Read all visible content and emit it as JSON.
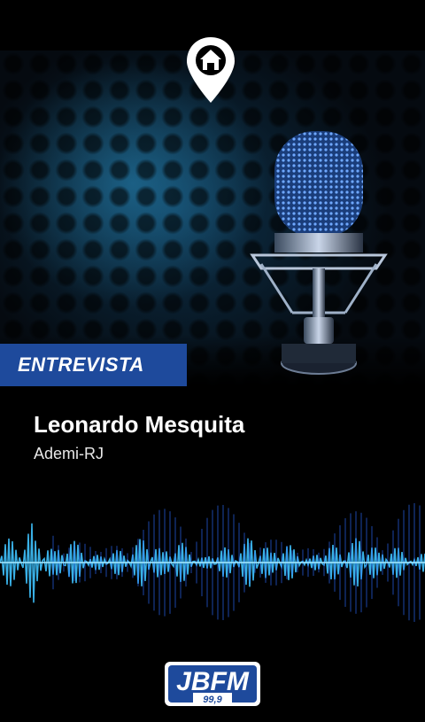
{
  "header": {
    "icon": "home-location-pin-icon"
  },
  "hero": {
    "image": "studio-microphone"
  },
  "tag": {
    "label": "ENTREVISTA",
    "color": "#1e4a9c"
  },
  "guest": {
    "name": "Leonardo Mesquita",
    "organization": "Ademi-RJ"
  },
  "footer": {
    "logo_text": "JBFM",
    "frequency": "99,9"
  },
  "colors": {
    "accent": "#1e4a9c",
    "wave": "#3fc3ff",
    "background": "#000000"
  }
}
